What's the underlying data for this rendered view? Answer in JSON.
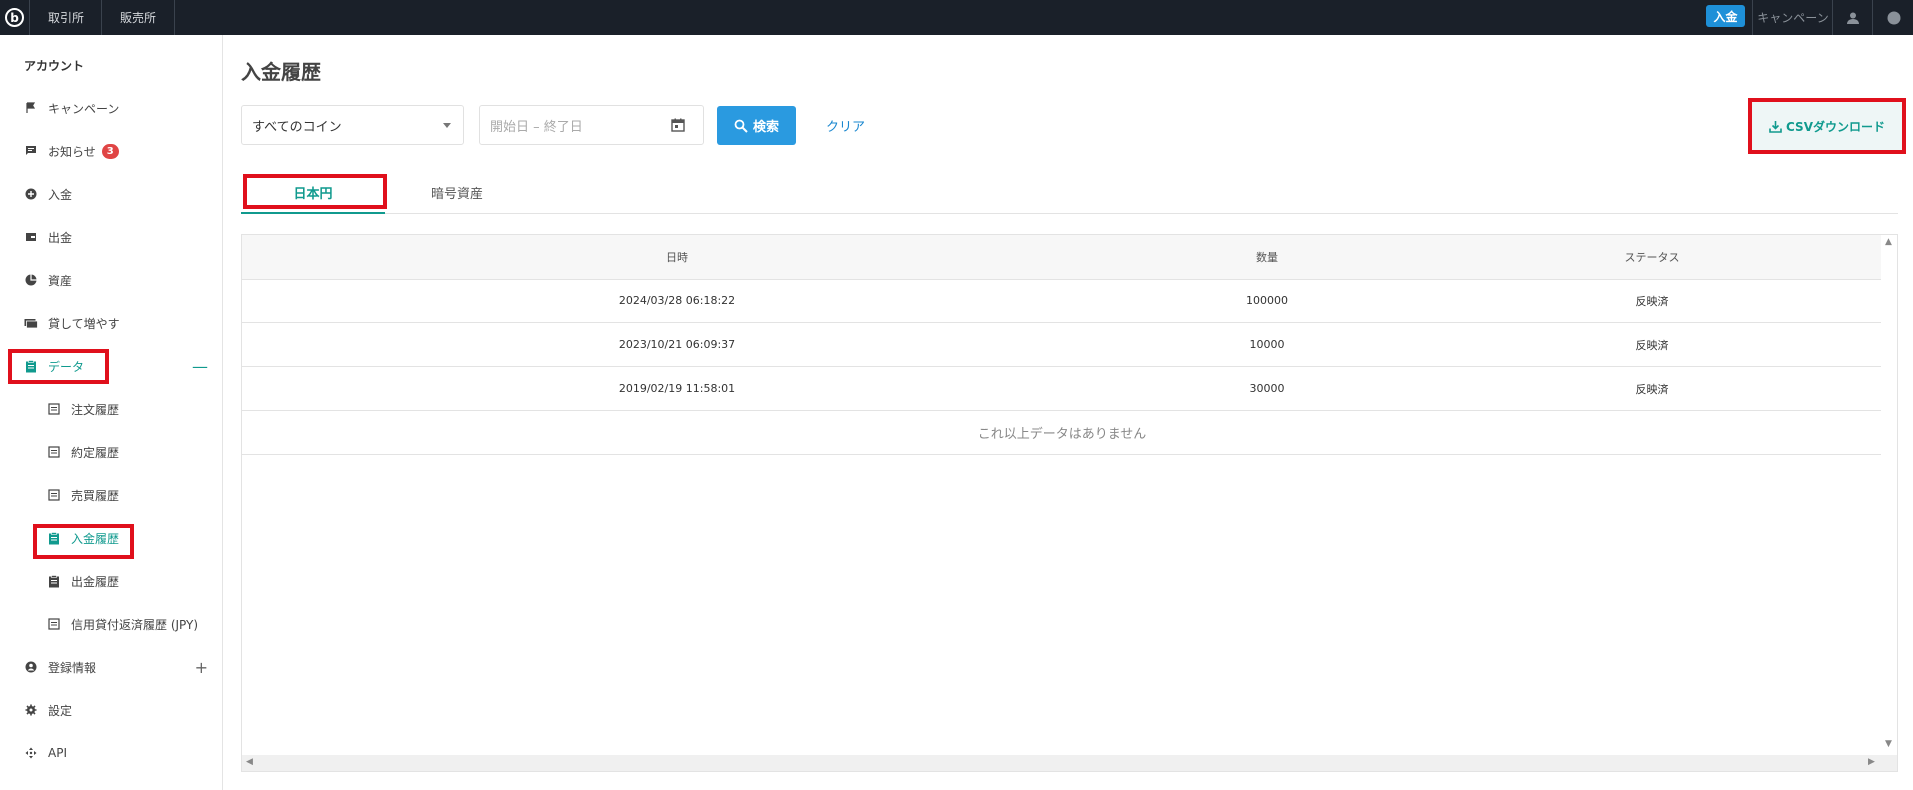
{
  "topbar": {
    "logo_letter": "b",
    "nav": [
      "取引所",
      "販売所"
    ],
    "deposit_label": "入金",
    "campaign_label": "キャンペーン",
    "help_label": "?"
  },
  "sidebar": {
    "title": "アカウント",
    "items": [
      {
        "label": "キャンペーン",
        "icon": "flag-icon"
      },
      {
        "label": "お知らせ",
        "icon": "message-icon",
        "badge": "3"
      },
      {
        "label": "入金",
        "icon": "plus-circle-icon"
      },
      {
        "label": "出金",
        "icon": "wallet-icon"
      },
      {
        "label": "資産",
        "icon": "pie-chart-icon"
      },
      {
        "label": "貸して増やす",
        "icon": "lend-icon"
      },
      {
        "label": "データ",
        "icon": "clipboard-icon",
        "toggle": "—"
      }
    ],
    "sub_items": [
      {
        "label": "注文履歴",
        "icon": "document-icon"
      },
      {
        "label": "約定履歴",
        "icon": "document-icon"
      },
      {
        "label": "売買履歴",
        "icon": "document-icon"
      },
      {
        "label": "入金履歴",
        "icon": "clipboard-icon"
      },
      {
        "label": "出金履歴",
        "icon": "clipboard-icon"
      },
      {
        "label": "信用貸付返済履歴 (JPY)",
        "icon": "document-icon"
      }
    ],
    "bottom_items": [
      {
        "label": "登録情報",
        "icon": "user-circle-icon",
        "toggle": "+"
      },
      {
        "label": "設定",
        "icon": "gear-icon"
      },
      {
        "label": "API",
        "icon": "api-icon"
      }
    ]
  },
  "main": {
    "title": "入金履歴",
    "coin_select": "すべてのコイン",
    "date_placeholder": "開始日 – 終了日",
    "search_label": "検索",
    "clear_label": "クリア",
    "csv_label": "CSVダウンロード",
    "tabs": [
      "日本円",
      "暗号資産"
    ],
    "table": {
      "headers": [
        "日時",
        "数量",
        "ステータス"
      ],
      "rows": [
        [
          "2024/03/28 06:18:22",
          "100000",
          "反映済"
        ],
        [
          "2023/10/21 06:09:37",
          "10000",
          "反映済"
        ],
        [
          "2019/02/19 11:58:01",
          "30000",
          "反映済"
        ]
      ],
      "no_more": "これ以上データはありません"
    }
  },
  "colors": {
    "topbar_bg": "#1a2029",
    "accent": "#109a8e",
    "primary_button": "#2a9ae0",
    "highlight_box": "#e0101c"
  }
}
